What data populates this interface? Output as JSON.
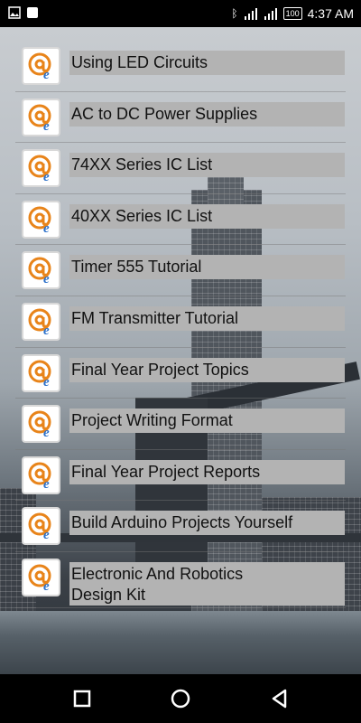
{
  "status_bar": {
    "time": "4:37 AM",
    "battery": "100",
    "left_icons": [
      "image-icon",
      "square-notification-icon"
    ],
    "right_icons": [
      "bluetooth-icon",
      "signal-icon",
      "signal-icon",
      "battery-icon"
    ]
  },
  "menu": {
    "icon_name": "at-e-logo-icon",
    "items": [
      {
        "label": "Using LED Circuits"
      },
      {
        "label": "AC to DC Power Supplies"
      },
      {
        "label": "74XX Series IC List"
      },
      {
        "label": "40XX Series IC List"
      },
      {
        "label": "Timer 555 Tutorial"
      },
      {
        "label": "FM Transmitter Tutorial"
      },
      {
        "label": "Final Year Project Topics"
      },
      {
        "label": "Project Writing Format"
      },
      {
        "label": "Final Year Project Reports"
      },
      {
        "label": "Build Arduino Projects Yourself"
      },
      {
        "label": "Electronic And Robotics\nDesign Kit"
      }
    ]
  },
  "nav_bar": {
    "buttons": [
      "recents-button",
      "home-button",
      "back-button"
    ]
  },
  "colors": {
    "label_bg": "#b3b3b3",
    "icon_orange": "#e8841a",
    "icon_blue": "#2a6fc9"
  }
}
